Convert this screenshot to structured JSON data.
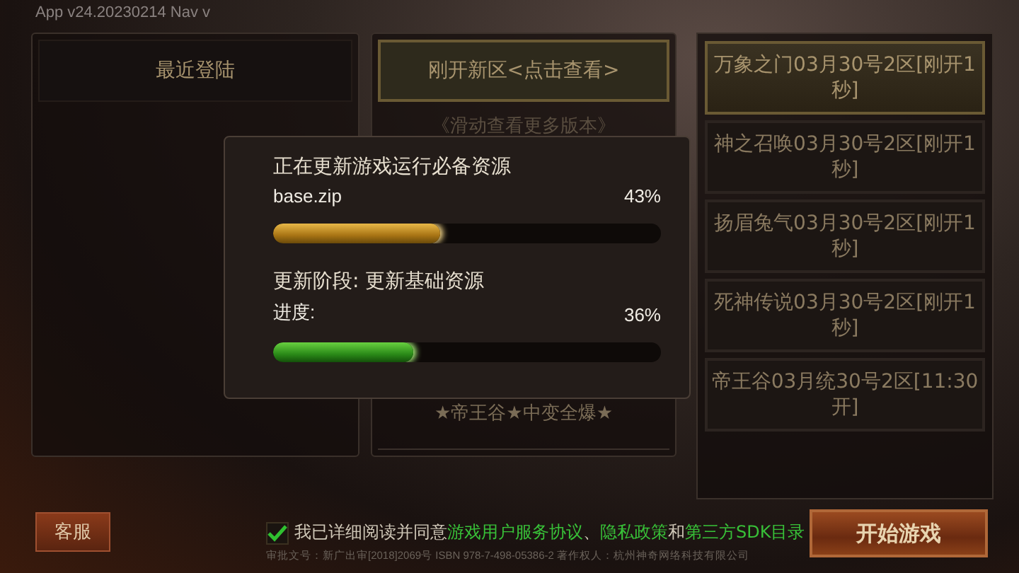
{
  "version_label": "App v24.20230214  Nav v",
  "recent_panel": {
    "title": "最近登陆"
  },
  "new_servers_panel": {
    "button": "刚开新区<点击查看>",
    "hint": "《滑动查看更多版本》",
    "items": [
      "★帝王谷★中变全爆★"
    ]
  },
  "server_list": [
    {
      "label": "万象之门03月30号2区[刚开1秒]",
      "selected": true
    },
    {
      "label": "神之召唤03月30号2区[刚开1秒]",
      "selected": false
    },
    {
      "label": "扬眉兔气03月30号2区[刚开1秒]",
      "selected": false
    },
    {
      "label": "死神传说03月30号2区[刚开1秒]",
      "selected": false
    },
    {
      "label": "帝王谷03月统30号2区[11:30开]",
      "selected": false
    }
  ],
  "update_dialog": {
    "title": "正在更新游戏运行必备资源",
    "file": "base.zip",
    "file_percent": "43%",
    "file_bar": {
      "level": 0.43
    },
    "stage": "更新阶段: 更新基础资源",
    "progress_label": "进度:",
    "progress_percent": "36%",
    "progress_bar": {
      "level": 0.36
    }
  },
  "support_button": "客服",
  "agreement": {
    "checked": true,
    "parts": [
      {
        "kind": "text",
        "text": "我已详细阅读并同意"
      },
      {
        "kind": "link",
        "text": "游戏用户服务协议"
      },
      {
        "kind": "text",
        "text": "、"
      },
      {
        "kind": "link",
        "text": "隐私政策"
      },
      {
        "kind": "text",
        "text": "和"
      },
      {
        "kind": "link",
        "text": "第三方SDK目录"
      }
    ]
  },
  "legal_notice": "审批文号：新广出审[2018]2069号 ISBN 978-7-498-05386-2 著作权人：杭州神奇网络科技有限公司",
  "start_button": "开始游戏"
}
